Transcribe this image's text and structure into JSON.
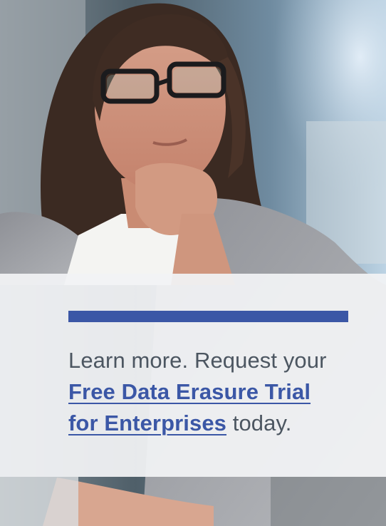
{
  "hero": {
    "image": "photo-woman-with-glasses-thinking"
  },
  "cta": {
    "lead": "Learn more. Request your",
    "link_line_1": "Free Data Erasure Trial",
    "link_line_2": "for Enterprises",
    "tail": " today."
  },
  "colors": {
    "accent": "#3b57a6",
    "text": "#4c5661",
    "card_bg": "#f1f2f4"
  }
}
